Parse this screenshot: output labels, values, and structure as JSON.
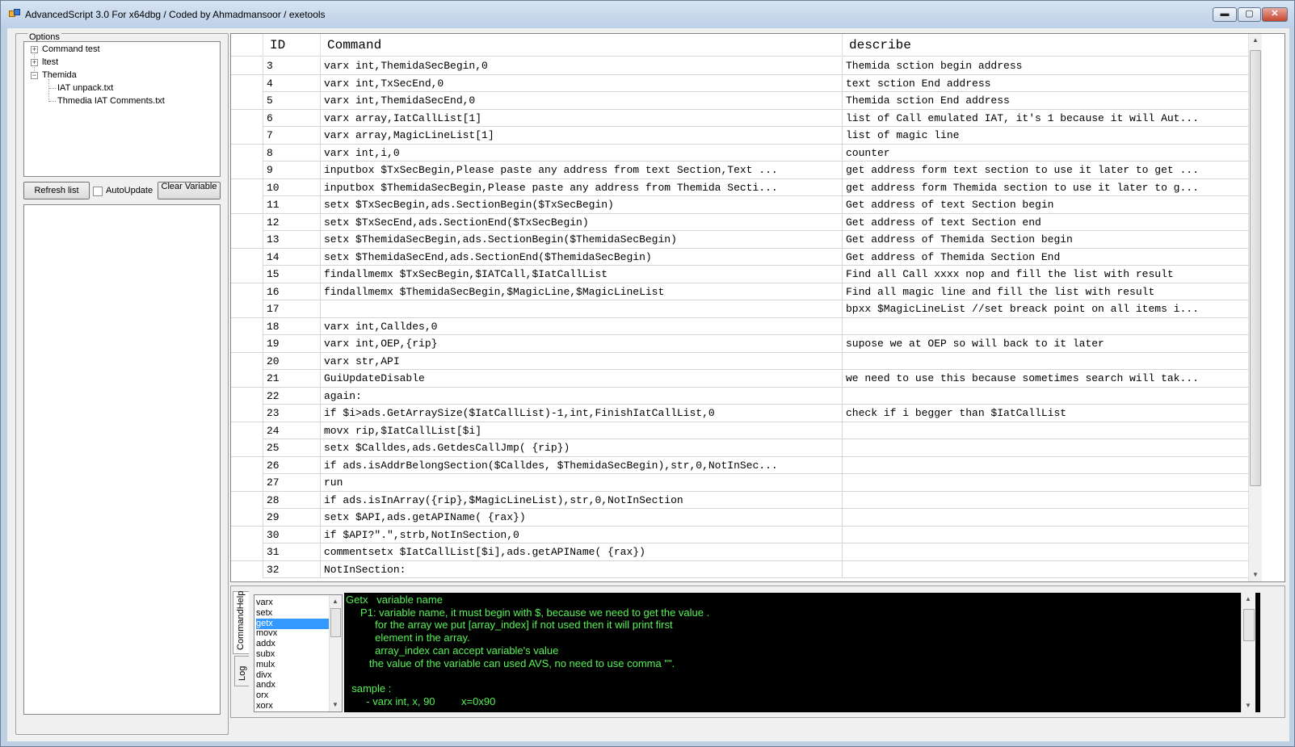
{
  "window": {
    "title": "AdvancedScript 3.0 For x64dbg / Coded by Ahmadmansoor / exetools",
    "min_glyph": "▬",
    "max_glyph": "▢",
    "close_glyph": "✕"
  },
  "options": {
    "legend": "Options",
    "tree": [
      {
        "label": "Command test",
        "toggle": "+"
      },
      {
        "label": "ltest",
        "toggle": "+"
      },
      {
        "label": "Themida",
        "toggle": "−"
      },
      {
        "label": "IAT unpack.txt"
      },
      {
        "label": "Thmedia IAT Comments.txt"
      }
    ],
    "refresh_label": "Refresh list",
    "autoupdate_label": "AutoUpdate",
    "autoupdate_checked": false,
    "clear_label": "Clear Variable"
  },
  "grid": {
    "columns": {
      "id": "ID",
      "command": "Command",
      "describe": "describe"
    },
    "rows": [
      {
        "id": "3",
        "command": "varx int,ThemidaSecBegin,0",
        "describe": "Themida sction begin address"
      },
      {
        "id": "4",
        "command": "varx int,TxSecEnd,0",
        "describe": "text sction End address"
      },
      {
        "id": "5",
        "command": "varx int,ThemidaSecEnd,0",
        "describe": "Themida sction End address"
      },
      {
        "id": "6",
        "command": "varx array,IatCallList[1]",
        "describe": "list of Call emulated IAT, it's 1 because it will Aut..."
      },
      {
        "id": "7",
        "command": "varx array,MagicLineList[1]",
        "describe": "list of magic line"
      },
      {
        "id": "8",
        "command": "varx int,i,0",
        "describe": "counter"
      },
      {
        "id": "9",
        "command": "inputbox $TxSecBegin,Please paste any address from text Section,Text ...",
        "describe": "get address form text section to use it later to get ..."
      },
      {
        "id": "10",
        "command": "inputbox $ThemidaSecBegin,Please paste any address from Themida Secti...",
        "describe": "get address form Themida section to use it later to g..."
      },
      {
        "id": "11",
        "command": "setx $TxSecBegin,ads.SectionBegin($TxSecBegin)",
        "describe": "Get address of text Section begin"
      },
      {
        "id": "12",
        "command": "setx $TxSecEnd,ads.SectionEnd($TxSecBegin)",
        "describe": "Get address of text Section end"
      },
      {
        "id": "13",
        "command": "setx $ThemidaSecBegin,ads.SectionBegin($ThemidaSecBegin)",
        "describe": "Get address of Themida Section begin"
      },
      {
        "id": "14",
        "command": "setx $ThemidaSecEnd,ads.SectionEnd($ThemidaSecBegin)",
        "describe": "Get address of Themida Section End"
      },
      {
        "id": "15",
        "command": "findallmemx $TxSecBegin,$IATCall,$IatCallList",
        "describe": "Find all Call xxxx nop and fill the list with result"
      },
      {
        "id": "16",
        "command": "findallmemx $ThemidaSecBegin,$MagicLine,$MagicLineList",
        "describe": "Find all magic line and fill the list with result"
      },
      {
        "id": "17",
        "command": "",
        "describe": "bpxx $MagicLineList //set breack point on all items i..."
      },
      {
        "id": "18",
        "command": "varx int,Calldes,0",
        "describe": ""
      },
      {
        "id": "19",
        "command": "varx int,OEP,{rip}",
        "describe": "supose we at OEP so will back to it later"
      },
      {
        "id": "20",
        "command": "varx str,API",
        "describe": ""
      },
      {
        "id": "21",
        "command": "GuiUpdateDisable",
        "describe": "we need to use this because sometimes search will tak..."
      },
      {
        "id": "22",
        "command": "again:",
        "describe": ""
      },
      {
        "id": "23",
        "command": "if $i>ads.GetArraySize($IatCallList)-1,int,FinishIatCallList,0",
        "describe": "check if i begger than $IatCallList"
      },
      {
        "id": "24",
        "command": "movx rip,$IatCallList[$i]",
        "describe": ""
      },
      {
        "id": "25",
        "command": "setx $Calldes,ads.GetdesCallJmp( {rip})",
        "describe": ""
      },
      {
        "id": "26",
        "command": "if ads.isAddrBelongSection($Calldes, $ThemidaSecBegin),str,0,NotInSec...",
        "describe": ""
      },
      {
        "id": "27",
        "command": "run",
        "describe": ""
      },
      {
        "id": "28",
        "command": "if ads.isInArray({rip},$MagicLineList),str,0,NotInSection",
        "describe": ""
      },
      {
        "id": "29",
        "command": "setx $API,ads.getAPIName( {rax})",
        "describe": ""
      },
      {
        "id": "30",
        "command": "if $API?\".\",strb,NotInSection,0",
        "describe": ""
      },
      {
        "id": "31",
        "command": "commentsetx $IatCallList[$i],ads.getAPIName( {rax})",
        "describe": ""
      },
      {
        "id": "32",
        "command": "NotInSection:",
        "describe": ""
      }
    ]
  },
  "bottom": {
    "tab_cmdhelp": "CommandHelp",
    "tab_log": "Log",
    "commands": [
      "varx",
      "setx",
      "getx",
      "movx",
      "addx",
      "subx",
      "mulx",
      "divx",
      "andx",
      "orx",
      "xorx"
    ],
    "selected_command": "getx",
    "help_lines": [
      "Getx   variable name",
      "     P1: variable name, it must begin with $, because we need to get the value .",
      "          for the array we put [array_index] if not used then it will print first",
      "          element in the array.",
      "          array_index can accept variable's value",
      "        the value of the variable can used AVS, no need to use comma \"\".",
      "",
      "  sample :",
      "       - varx int, x, 90         x=0x90"
    ]
  }
}
